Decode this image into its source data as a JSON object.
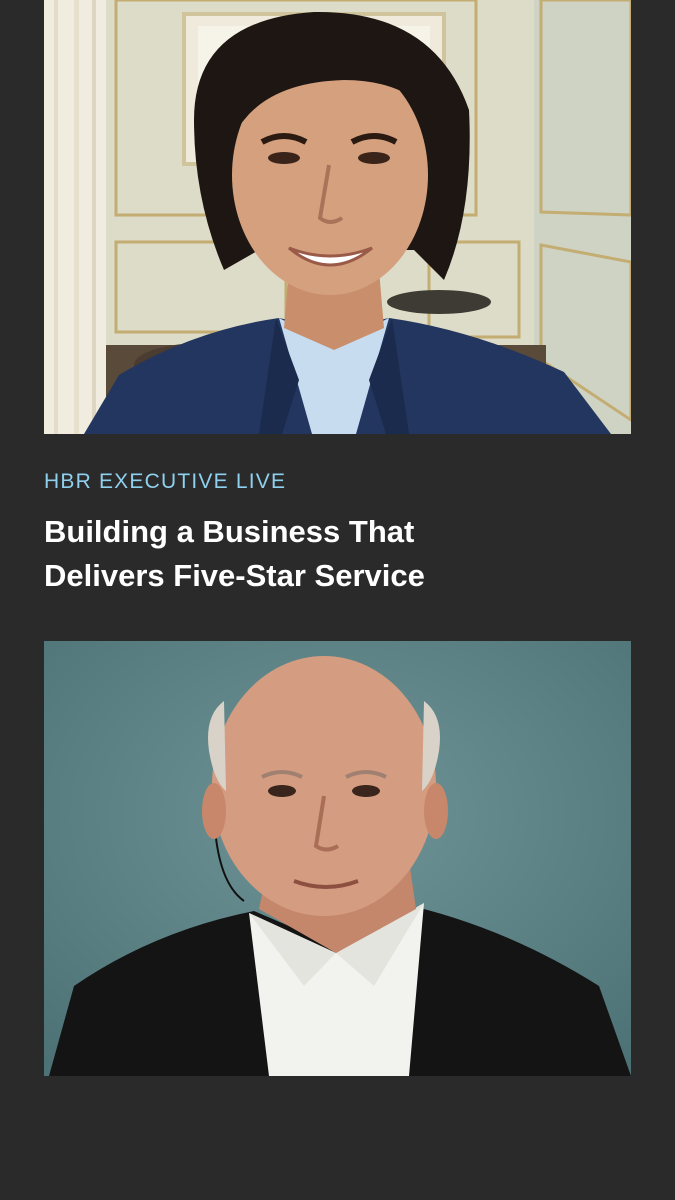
{
  "brand": {
    "series_label": "HBR EXECUTIVE LIVE",
    "accent_color": "#8fd0ee",
    "background_color": "#2a2a2a"
  },
  "headline": {
    "line1": "Building a Business That",
    "line2": "Delivers Five-Star Service"
  },
  "participants": [
    {
      "video": "participant-video-top",
      "background": "hotel room with cream paneled walls and sheer curtains"
    },
    {
      "video": "participant-video-bottom",
      "background": "plain teal studio backdrop"
    }
  ]
}
